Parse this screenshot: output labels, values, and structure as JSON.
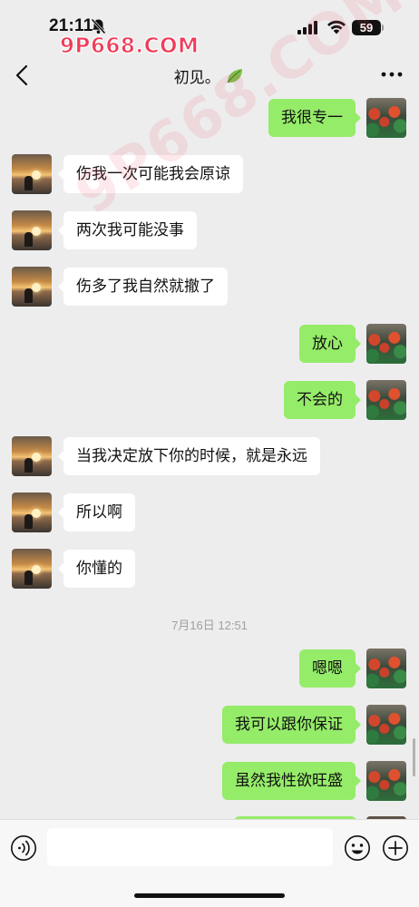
{
  "status_bar": {
    "time": "21:11",
    "battery": "59",
    "watermark": "9P668.COM",
    "bell_icon": "bell-slash-icon",
    "signal_icon": "cellular-signal-icon",
    "wifi_icon": "wifi-icon"
  },
  "nav": {
    "title": "初见。",
    "back_icon": "chevron-left-icon",
    "leaf_icon": "leaf-icon",
    "more_icon": "more-dots-icon"
  },
  "watermark_overlay": "9P668.COM",
  "messages": [
    {
      "side": "right",
      "text": "我很专一"
    },
    {
      "side": "left",
      "text": "伤我一次可能我会原谅"
    },
    {
      "side": "left",
      "text": "两次我可能没事"
    },
    {
      "side": "left",
      "text": "伤多了我自然就撤了"
    },
    {
      "side": "right",
      "text": "放心"
    },
    {
      "side": "right",
      "text": "不会的"
    },
    {
      "side": "left",
      "text": "当我决定放下你的时候，就是永远"
    },
    {
      "side": "left",
      "text": "所以啊"
    },
    {
      "side": "left",
      "text": "你懂的"
    },
    {
      "side": "right",
      "text": "嗯嗯"
    },
    {
      "side": "right",
      "text": "我可以跟你保证"
    },
    {
      "side": "right",
      "text": "虽然我性欲旺盛"
    }
  ],
  "timestamp": "7月16日 12:51",
  "input_bar": {
    "voice_icon": "voice-icon",
    "emoji_icon": "emoji-smile-icon",
    "plus_icon": "plus-circle-icon",
    "input_placeholder": ""
  },
  "colors": {
    "background": "#ededed",
    "bubble_right": "#95ec69",
    "bubble_left": "#ffffff"
  }
}
